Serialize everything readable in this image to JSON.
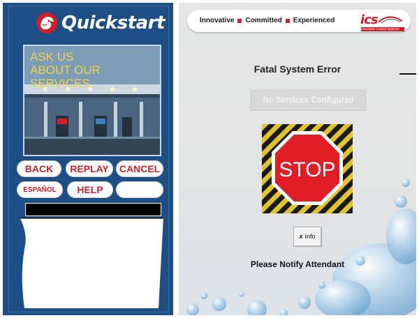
{
  "left_panel": {
    "brand": "Quickstart",
    "ad_lines": [
      "ASK US",
      "ABOUT OUR",
      "SERVICES..."
    ],
    "buttons": {
      "back": "BACK",
      "replay": "REPLAY",
      "cancel": "CANCEL",
      "espanol": "ESPAÑOL",
      "help": "HELP",
      "blank": ""
    }
  },
  "header": {
    "tagline": [
      "Innovative",
      "Committed",
      "Experienced"
    ],
    "logo_name": "ics",
    "logo_sub": "Innovative Control Systems"
  },
  "main": {
    "title": "Fatal System Error",
    "status_button": "No Services Configured",
    "stop_sign": "STOP",
    "info_button": {
      "icon": "x",
      "label": "Info"
    },
    "notify": "Please Notify Attendant"
  },
  "colors": {
    "panel_blue": "#1d4f86",
    "accent_red": "#d11f2a",
    "ad_text_yellow": "#f2d54b"
  }
}
